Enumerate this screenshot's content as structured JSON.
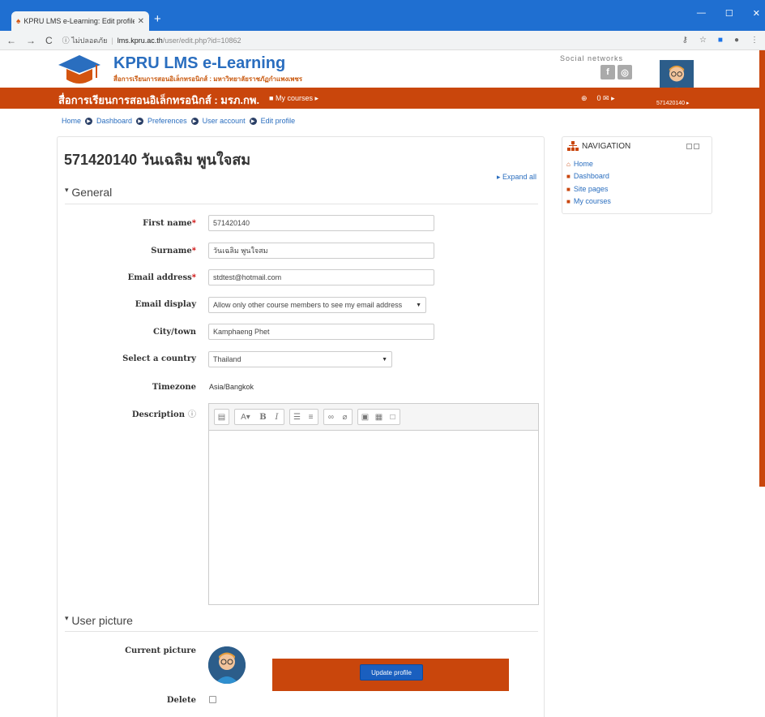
{
  "browser": {
    "tab_title": "KPRU LMS e-Learning: Edit profile",
    "new_tab": "+",
    "security_label": "ไม่ปลอดภัย",
    "url_host": "lms.kpru.ac.th",
    "url_path": "/user/edit.php?id=10862"
  },
  "site": {
    "title": "KPRU LMS e-Learning",
    "subtitle": "สื่อการเรียนการสอนอิเล็กทรอนิกส์ : มหาวิทยาลัยราชภัฏกำแพงเพชร",
    "social_label": "Social networks",
    "facebook": "f",
    "other_social": "◎"
  },
  "navbar": {
    "title": "สื่อการเรียนการสอนอิเล็กทรอนิกส์ : มรภ.กพ.",
    "my_courses": "My courses ▸",
    "alerts": "⊕",
    "messages": "0 ✉ ▸",
    "user": "571420140 ▸"
  },
  "breadcrumb": {
    "home": "Home",
    "dashboard": "Dashboard",
    "preferences": "Preferences",
    "user_account": "User account",
    "edit_profile": "Edit profile"
  },
  "page": {
    "title": "571420140 วันเฉลิม พูนใจสม",
    "expand_all": "▸ Expand all"
  },
  "general": {
    "heading": "General",
    "first_name_label": "First name",
    "first_name_value": "571420140",
    "surname_label": "Surname",
    "surname_value": "วันเฉลิม พูนใจสม",
    "email_label": "Email address",
    "email_value": "stdtest@hotmail.com",
    "email_display_label": "Email display",
    "email_display_value": "Allow only other course members to see my email address",
    "city_label": "City/town",
    "city_value": "Kamphaeng Phet",
    "country_label": "Select a country",
    "country_value": "Thailand",
    "timezone_label": "Timezone",
    "timezone_value": "Asia/Bangkok",
    "description_label": "Description"
  },
  "user_picture": {
    "heading": "User picture",
    "current_label": "Current picture",
    "update_button": "Update profile",
    "delete_label": "Delete"
  },
  "navigation": {
    "heading": "NAVIGATION",
    "items": [
      "Home",
      "Dashboard",
      "Site pages",
      "My courses"
    ]
  }
}
